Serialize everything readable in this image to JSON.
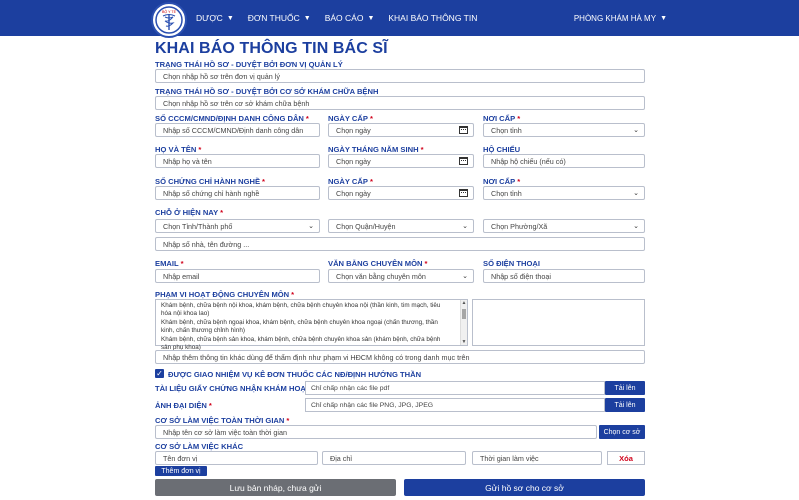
{
  "nav": {
    "items": [
      {
        "label": "DƯỢC",
        "dropdown": true
      },
      {
        "label": "ĐƠN THUỐC",
        "dropdown": true
      },
      {
        "label": "BÁO CÁO",
        "dropdown": true
      },
      {
        "label": "KHAI BÁO THÔNG TIN",
        "dropdown": false
      }
    ],
    "clinic": "PHÒNG KHÁM HÀ MY",
    "logo_text_top": "BỘ Y TẾ"
  },
  "page_title": "KHAI BÁO THÔNG TIN BÁC SĨ",
  "status_mgr": {
    "label": "TRẠNG THÁI HỒ SƠ - DUYỆT BỞI ĐƠN VỊ QUẢN LÝ",
    "placeholder": "Chọn nhập hồ sơ trên đơn vị quản lý"
  },
  "status_clinic": {
    "label": "TRẠNG THÁI HỒ SƠ - DUYỆT BỞI CƠ SỞ KHÁM CHỮA BỆNH",
    "placeholder": "Chọn nhập hồ sơ trên cơ sở khám chữa bệnh"
  },
  "id_number": {
    "label": "SỐ CCCM/CMND/ĐỊNH DANH CÔNG DÂN",
    "placeholder": "Nhập số CCCM/CMND/Định danh công dân"
  },
  "id_issue_date": {
    "label": "NGÀY CẤP",
    "placeholder": "Chọn ngày"
  },
  "id_issue_place": {
    "label": "NƠI CẤP",
    "placeholder": "Chọn tỉnh"
  },
  "full_name": {
    "label": "HỌ VÀ TÊN",
    "placeholder": "Nhập họ và tên"
  },
  "birth_date": {
    "label": "NGÀY THÁNG NĂM SINH",
    "placeholder": "Chọn ngày"
  },
  "passport": {
    "label": "HỘ CHIẾU",
    "placeholder": "Nhập hộ chiếu (nếu có)"
  },
  "license_no": {
    "label": "SỐ CHỨNG CHỈ HÀNH NGHỀ",
    "placeholder": "Nhập số chứng chỉ hành nghề"
  },
  "license_date": {
    "label": "NGÀY CẤP",
    "placeholder": "Chọn ngày"
  },
  "license_place": {
    "label": "NƠI CẤP",
    "placeholder": "Chọn tỉnh"
  },
  "address": {
    "label": "CHỖ Ở HIỆN NAY",
    "province": "Chọn Tỉnh/Thành phố",
    "district": "Chọn Quận/Huyện",
    "ward": "Chọn Phường/Xã",
    "street_placeholder": "Nhập số nhà, tên đường ..."
  },
  "email": {
    "label": "EMAIL",
    "placeholder": "Nhập email"
  },
  "degree": {
    "label": "VĂN BẰNG CHUYÊN MÔN",
    "placeholder": "Chọn văn bằng chuyên môn"
  },
  "phone": {
    "label": "SỐ ĐIỆN THOẠI",
    "placeholder": "Nhập số điện thoại"
  },
  "scope": {
    "label": "PHẠM VI HOẠT ĐỘNG CHUYÊN MÔN",
    "options": [
      "Khám bệnh, chữa bệnh nội khoa, khám bệnh, chữa bệnh chuyên khoa nội (thần kinh, tim mạch, tiêu hóa nội khoa lao)",
      "Khám bệnh, chữa bệnh ngoại khoa, khám bệnh, chữa bệnh chuyên khoa ngoại (chấn thương, thần kinh, chấn thương chỉnh hình)",
      "Khám bệnh, chữa bệnh sản khoa, khám bệnh, chữa bệnh chuyên khoa sản (khám bệnh, chữa bệnh sản phụ khoa)"
    ],
    "other_placeholder": "Nhập thêm thông tin khác dùng để thẩm định như phạm vi HĐCM không có trong danh mục trên"
  },
  "assigned": {
    "label": "ĐƯỢC GIAO NHIỆM VỤ KÊ ĐƠN THUỐC CÁC NĐ/ĐỊNH HƯỚNG THẦN",
    "checked": true
  },
  "cert_doc": {
    "label": "TÀI LIỆU GIẤY CHỨNG NHẬN KHÁM HOẠT",
    "hint": "Chỉ chấp nhận các file pdf",
    "button": "Tải lên"
  },
  "avatar": {
    "label": "ẢNH ĐẠI DIỆN",
    "hint": "Chỉ chấp nhận các file PNG, JPG, JPEG",
    "button": "Tải lên"
  },
  "fulltime": {
    "label": "CƠ SỞ LÀM VIỆC TOÀN THỜI GIAN",
    "placeholder": "Nhập tên cơ sở làm việc toàn thời gian",
    "button": "Chọn cơ sở"
  },
  "other_work": {
    "label": "CƠ SỞ LÀM VIỆC KHÁC",
    "unit_placeholder": "Tên đơn vị",
    "address_placeholder": "Địa chỉ",
    "time_placeholder": "Thời gian làm việc",
    "delete": "Xóa",
    "add_button": "Thêm đơn vị"
  },
  "actions": {
    "draft": "Lưu bản nháp, chưa gửi",
    "submit": "Gửi hồ sơ cho cơ sở"
  },
  "colors": {
    "primary": "#1c3f9f",
    "required": "#d0021b",
    "draft": "#6b6e74"
  }
}
